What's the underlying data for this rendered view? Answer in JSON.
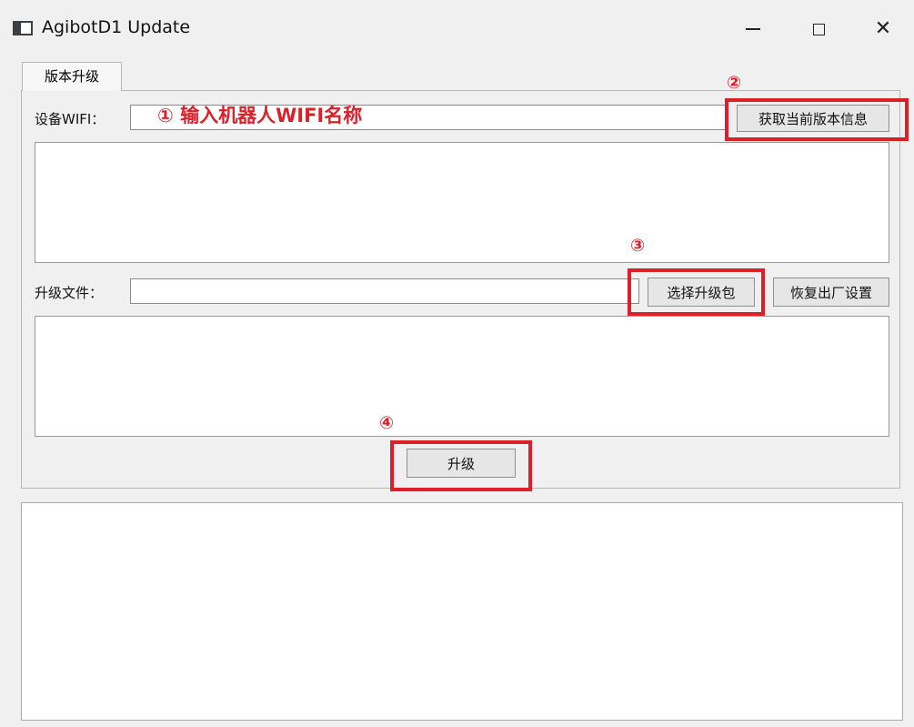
{
  "window": {
    "title": "AgibotD1 Update",
    "controls": {
      "minimize": "—",
      "close": "✕"
    }
  },
  "tabs": [
    {
      "label": "版本升级"
    }
  ],
  "wifi_row": {
    "label": "设备WIFI：",
    "input_value": "",
    "annotation": "① 输入机器人WIFI名称",
    "get_version_button": "获取当前版本信息",
    "step_number": "②"
  },
  "file_row": {
    "label": "升级文件：",
    "input_value": "",
    "select_package_button": "选择升级包",
    "factory_reset_button": "恢复出厂设置",
    "step_number": "③"
  },
  "upgrade": {
    "button": "升级",
    "step_number": "④"
  },
  "colors": {
    "annotation_red": "#dd1f2a",
    "window_bg": "#f0f0f0",
    "field_bg": "#ffffff"
  }
}
